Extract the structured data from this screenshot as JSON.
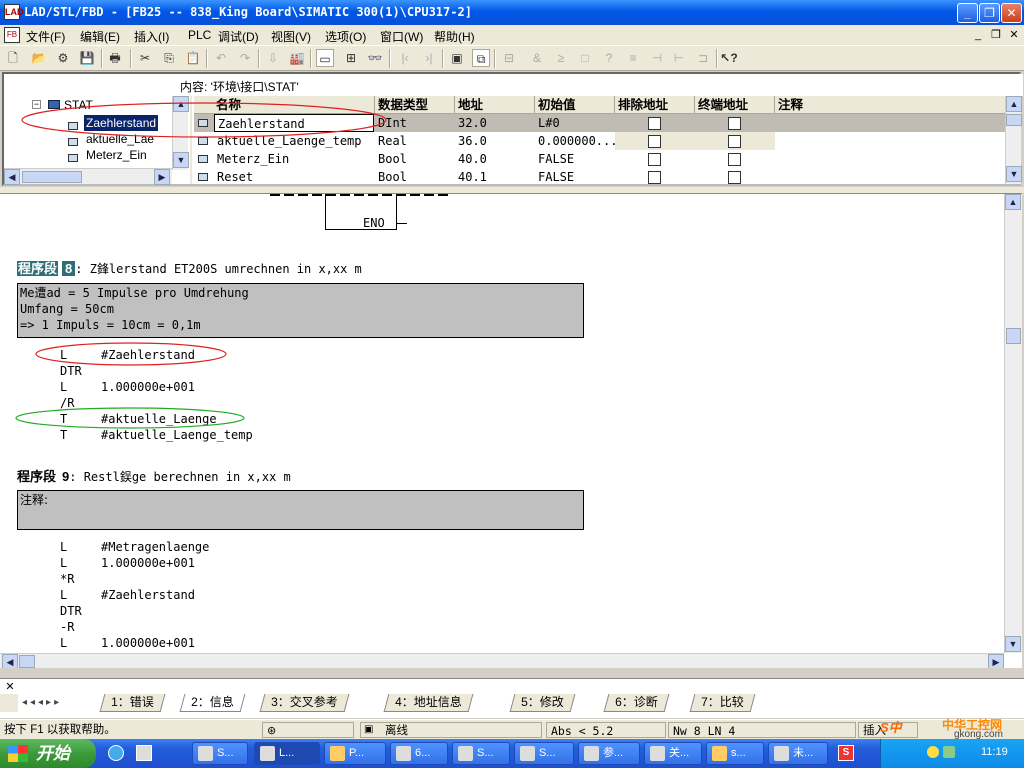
{
  "window": {
    "title": "LAD/STL/FBD  - [FB25 -- 838_King Board\\SIMATIC 300(1)\\CPU317-2]"
  },
  "menu": [
    "文件(F)",
    "编辑(E)",
    "插入(I)",
    "PLC",
    "调试(D)",
    "视图(V)",
    "选项(O)",
    "窗口(W)",
    "帮助(H)"
  ],
  "decl": {
    "content_label": "内容:  '环境\\接口\\STAT'",
    "tree": {
      "root": "STAT",
      "items": [
        "Zaehlerstand",
        "aktuelle_Lae",
        "Meterz_Ein"
      ]
    },
    "columns": [
      "名称",
      "数据类型",
      "地址",
      "初始值",
      "排除地址",
      "终端地址",
      "注释"
    ],
    "rows": [
      {
        "name": "Zaehlerstand",
        "type": "DInt",
        "addr": "32.0",
        "init": "L#0"
      },
      {
        "name": "aktuelle_Laenge_temp",
        "type": "Real",
        "addr": "36.0",
        "init": "0.000000..."
      },
      {
        "name": "Meterz_Ein",
        "type": "Bool",
        "addr": "40.0",
        "init": "FALSE"
      },
      {
        "name": "Reset",
        "type": "Bool",
        "addr": "40.1",
        "init": "FALSE"
      }
    ]
  },
  "editor": {
    "eno_label": "ENO",
    "nw8": {
      "title_label": "程序段",
      "num": "8",
      "title_text": ": Z鋒lerstand ET200S umrechnen in x,xx m",
      "comment": [
        "Me遭ad = 5 Impulse pro Umdrehung",
        "Umfang = 50cm",
        "=> 1 Impuls = 10cm = 0,1m"
      ],
      "code": [
        {
          "op": "L",
          "arg": "#Zaehlerstand"
        },
        {
          "op": "DTR",
          "arg": ""
        },
        {
          "op": "L",
          "arg": "1.000000e+001"
        },
        {
          "op": "/R",
          "arg": ""
        },
        {
          "op": "T",
          "arg": "#aktuelle_Laenge"
        },
        {
          "op": "T",
          "arg": "#aktuelle_Laenge_temp"
        }
      ]
    },
    "nw9": {
      "title_label": "程序段",
      "num": "9",
      "title_text": ": Restl鋘ge berechnen in x,xx m",
      "comment": "注释:",
      "code": [
        {
          "op": "L",
          "arg": "#Metragenlaenge"
        },
        {
          "op": "L",
          "arg": "1.000000e+001"
        },
        {
          "op": "*R",
          "arg": ""
        },
        {
          "op": "L",
          "arg": "#Zaehlerstand"
        },
        {
          "op": "DTR",
          "arg": ""
        },
        {
          "op": "-R",
          "arg": ""
        },
        {
          "op": "L",
          "arg": "1.000000e+001"
        }
      ]
    }
  },
  "tabs": [
    "1：错误",
    "2：信息",
    "3：交叉参考",
    "4：地址信息",
    "5：修改",
    "6：诊断",
    "7：比较"
  ],
  "status": {
    "help": "按下 F1 以获取帮助。",
    "offline": "离线",
    "abs": "Abs < 5.2",
    "nw_ln": "Nw 8   LN 4",
    "mode": "插入"
  },
  "taskbar": {
    "start": "开始",
    "tasks": [
      "S...",
      "L...",
      "P...",
      "6...",
      "S...",
      "S...",
      "参...",
      "关...",
      "s...",
      "未..."
    ],
    "clock": "11:19",
    "watermark": "中华工控网",
    "watermark_url": "gkong.com"
  },
  "colors": {
    "titlebar": "#0a50d8",
    "selection": "#0a246a",
    "nw_highlight": "#2e6e78",
    "ellipse_red": "#e02020",
    "ellipse_green": "#22aa22"
  }
}
